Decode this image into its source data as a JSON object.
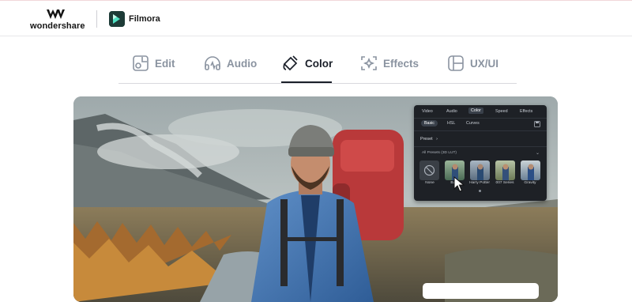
{
  "header": {
    "brand_name": "wondershare",
    "product_name": "Filmora"
  },
  "tabs": [
    {
      "label": "Edit",
      "icon": "edit-icon",
      "active": false
    },
    {
      "label": "Audio",
      "icon": "headphones-icon",
      "active": false
    },
    {
      "label": "Color",
      "icon": "paint-bucket-icon",
      "active": true
    },
    {
      "label": "Effects",
      "icon": "effects-sparkle-icon",
      "active": false
    },
    {
      "label": "UX/UI",
      "icon": "layout-icon",
      "active": false
    }
  ],
  "panel": {
    "tabs": [
      "Video",
      "Audio",
      "Color",
      "Speed",
      "Effects"
    ],
    "active_tab": "Color",
    "subtabs": [
      "Basic",
      "HSL",
      "Curves"
    ],
    "active_subtab": "Basic",
    "preset_label": "Preset",
    "preset_arrow": "›",
    "all_presets_label": "All Presets (3D LUT)",
    "presets": [
      {
        "label": "None",
        "icon": "no-filter-icon"
      },
      {
        "label": "Bat",
        "icon": "preset-thumbnail"
      },
      {
        "label": "Harry Potter",
        "icon": "preset-thumbnail"
      },
      {
        "label": "007 Series",
        "icon": "preset-thumbnail"
      },
      {
        "label": "Gravity",
        "icon": "preset-thumbnail"
      }
    ]
  },
  "colors": {
    "active_tab": "#1a1f29",
    "inactive_tab": "#8a93a0",
    "panel_bg": "#1e2126"
  }
}
